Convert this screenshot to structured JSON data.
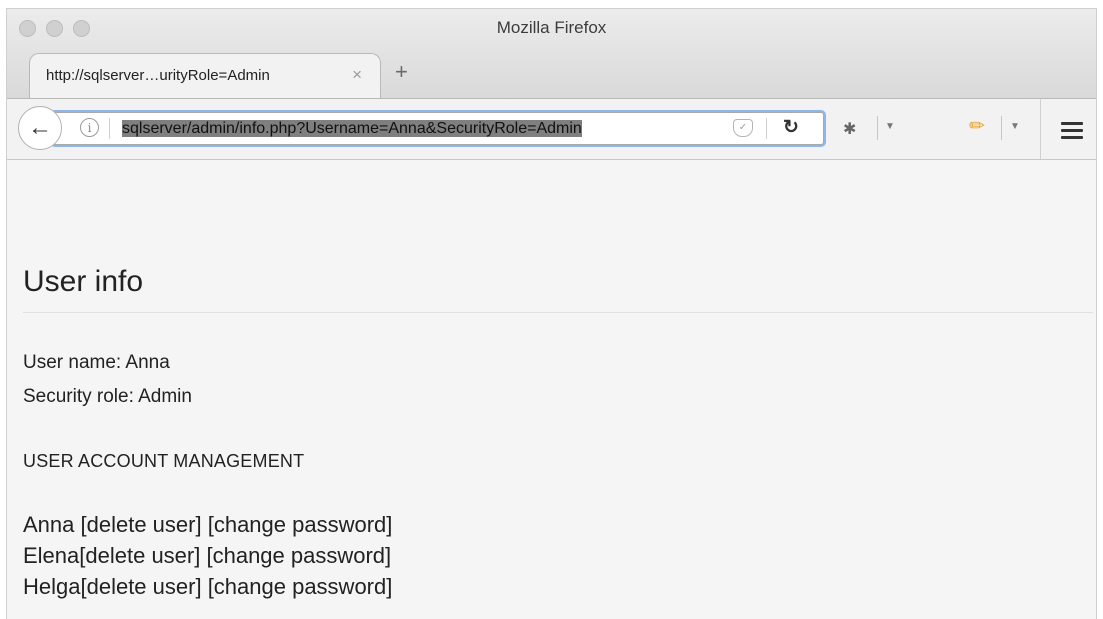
{
  "window": {
    "title": "Mozilla Firefox"
  },
  "tab": {
    "title": "http://sqlserver…urityRole=Admin",
    "close_glyph": "×",
    "new_tab_glyph": "+"
  },
  "toolbar": {
    "url": "sqlserver/admin/info.php?Username=Anna&SecurityRole=Admin"
  },
  "icons": {
    "back": "arrow-left-icon",
    "info": "info-icon",
    "pocket": "pocket-icon",
    "reload": "reload-icon",
    "bug": "bug-icon",
    "pencil": "pencil-icon",
    "menu": "hamburger-menu-icon"
  },
  "page": {
    "heading": "User info",
    "user_name_line": "User name: Anna",
    "security_role_line": "Security role: Admin",
    "section_title": "USER ACCOUNT MANAGEMENT",
    "users": [
      {
        "name": "Anna",
        "delete_label": "[delete user]",
        "change_label": "[change password]"
      },
      {
        "name": "Elena",
        "delete_label": "[delete user]",
        "change_label": "[change password]"
      },
      {
        "name": "Helga",
        "delete_label": "[delete user]",
        "change_label": "[change password]"
      }
    ]
  }
}
